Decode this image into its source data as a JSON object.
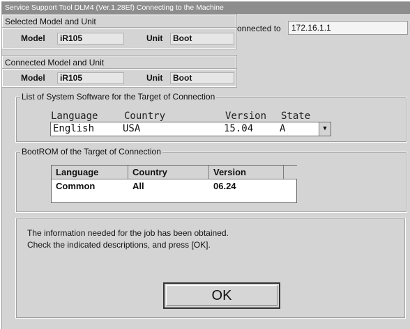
{
  "window": {
    "title": "Service Support Tool DLM4 (Ver.1.28Ef) Connecting to the Machine"
  },
  "selected": {
    "header": "Selected Model and Unit",
    "model_label": "Model",
    "model_value": "iR105",
    "unit_label": "Unit",
    "unit_value": "Boot"
  },
  "connection": {
    "label": "onnected to",
    "ip": "172.16.1.1"
  },
  "connected": {
    "header": "Connected Model and Unit",
    "model_label": "Model",
    "model_value": "iR105",
    "unit_label": "Unit",
    "unit_value": "Boot"
  },
  "system_software": {
    "legend": "List of System Software for the Target of Connection",
    "headers": [
      "Language",
      "Country",
      "Version",
      "State"
    ],
    "selected": {
      "language": "English",
      "country": "USA",
      "version": "15.04",
      "state": "A"
    },
    "dropdown_icon": "chevron-down-icon"
  },
  "bootrom": {
    "legend": "BootROM of the Target of Connection",
    "columns": [
      "Language",
      "Country",
      "Version"
    ],
    "rows": [
      {
        "language": "Common",
        "country": "All",
        "version": "06.24"
      }
    ]
  },
  "message": {
    "line1": "The information needed for the job has been obtained.",
    "line2": "Check the indicated descriptions, and press [OK]."
  },
  "ok_button": {
    "label": "OK"
  }
}
